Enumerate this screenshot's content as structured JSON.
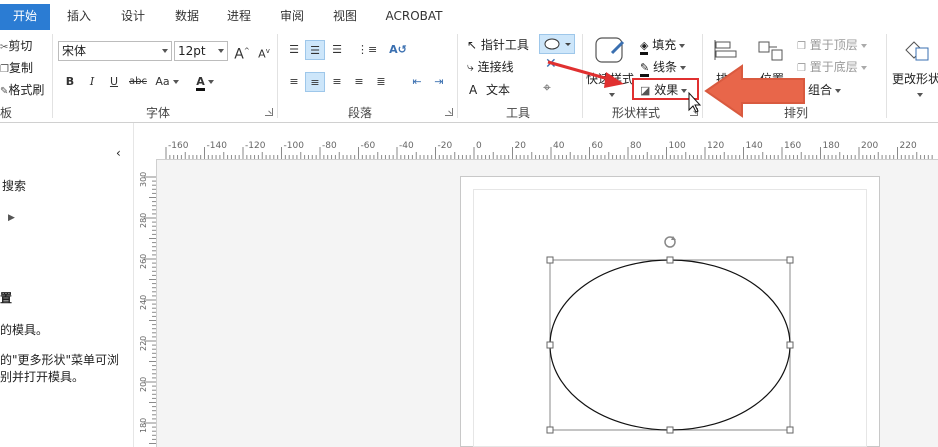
{
  "tabs": [
    "开始",
    "插入",
    "设计",
    "数据",
    "进程",
    "审阅",
    "视图",
    "ACROBAT"
  ],
  "clipboard": {
    "cut": "剪切",
    "copy": "复制",
    "format_painter": "格式刷",
    "label_partial": "板"
  },
  "font": {
    "name": "宋体",
    "size": "12pt",
    "label": "字体",
    "bold": "B",
    "italic": "I",
    "underline": "U",
    "strike": "abc",
    "case": "Aa",
    "grow": "A",
    "shrink": "A",
    "color": "A"
  },
  "paragraph": {
    "label": "段落"
  },
  "tools": {
    "pointer": "指针工具",
    "connector": "连接线",
    "text": "文本",
    "label": "工具"
  },
  "shape_styles": {
    "quick_styles": "快速样式",
    "fill": "填充",
    "line": "线条",
    "effects": "效果",
    "label": "形状样式"
  },
  "arrange": {
    "align_partial": "排",
    "position": "位置",
    "bring_front": "置于顶层",
    "send_back": "置于底层",
    "group": "组合",
    "label": "排列"
  },
  "change_shape": {
    "label": "更改形状"
  },
  "left_panel": {
    "search": "搜索",
    "section_partial": "置",
    "desc1": "的模具。",
    "desc2": "的\"更多形状\"菜单可浏",
    "desc3": "别并打开模具。"
  },
  "ruler": {
    "h_ticks": [
      "-160",
      "-140",
      "-120",
      "-100",
      "-80",
      "-60",
      "-40",
      "-20",
      "0",
      "20",
      "40",
      "60",
      "80",
      "100",
      "120",
      "140",
      "160",
      "180",
      "200",
      "220"
    ],
    "v_ticks": [
      "300",
      "280",
      "260",
      "240",
      "220",
      "200",
      "180"
    ]
  },
  "colors": {
    "accent": "#2b7cd3",
    "highlight": "#e03030",
    "arrow": "#e8664a",
    "selection": "#cde6fa"
  }
}
